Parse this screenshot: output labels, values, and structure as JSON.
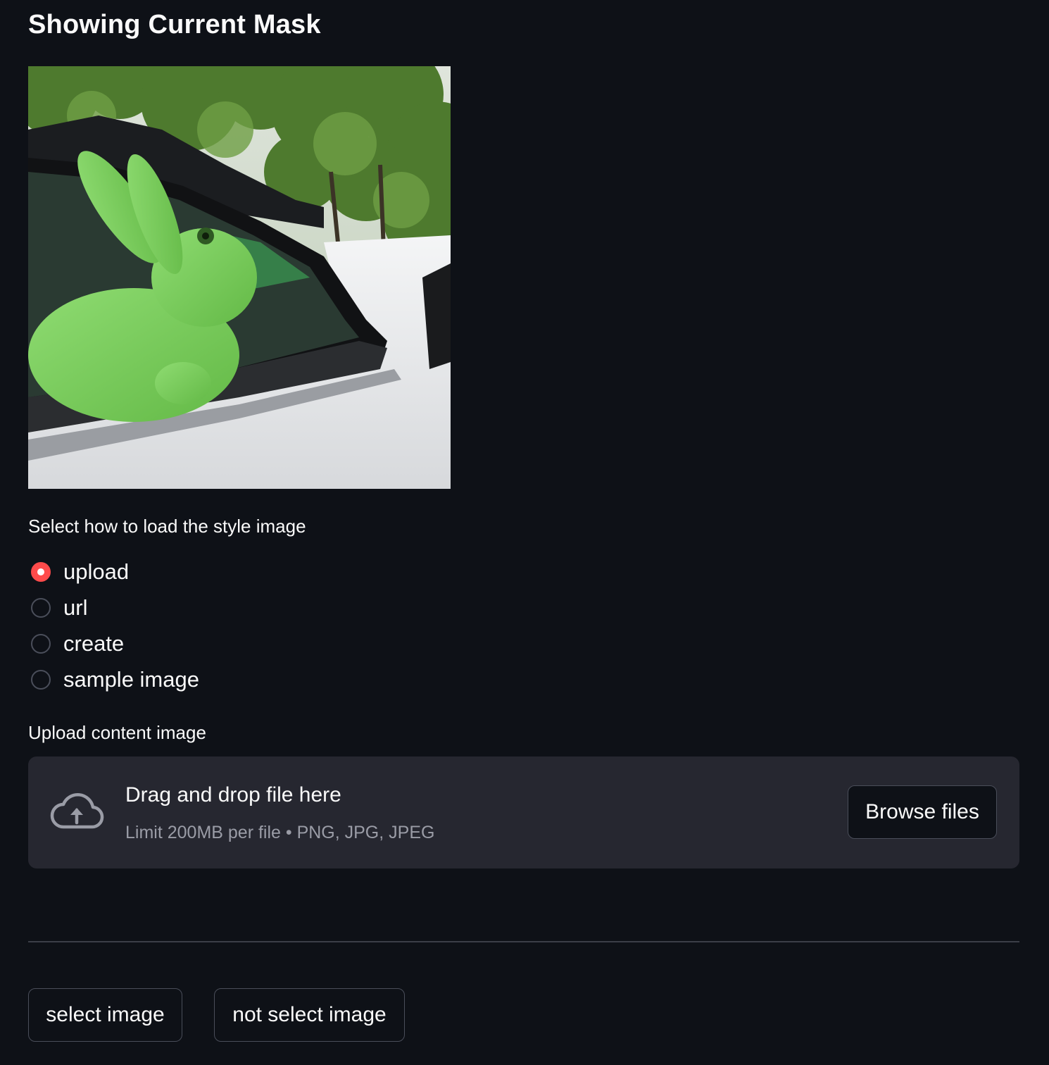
{
  "header": {
    "title": "Showing Current Mask"
  },
  "mask_image": {
    "subject": "green-masked rabbit in car window"
  },
  "style_loader": {
    "label": "Select how to load the style image",
    "options": [
      {
        "label": "upload",
        "checked": true
      },
      {
        "label": "url",
        "checked": false
      },
      {
        "label": "create",
        "checked": false
      },
      {
        "label": "sample image",
        "checked": false
      }
    ],
    "accent_color": "#ff4b4b"
  },
  "uploader": {
    "label": "Upload content image",
    "drop_text": "Drag and drop file here",
    "limit_text": "Limit 200MB per file • PNG, JPG, JPEG",
    "browse_label": "Browse files",
    "icon": "cloud-upload-icon"
  },
  "actions": {
    "select_label": "select image",
    "not_select_label": "not select image"
  },
  "theme": {
    "background": "#0e1117",
    "panel": "#262730",
    "text": "#fafafa",
    "muted_text": "#9a9ca6"
  }
}
